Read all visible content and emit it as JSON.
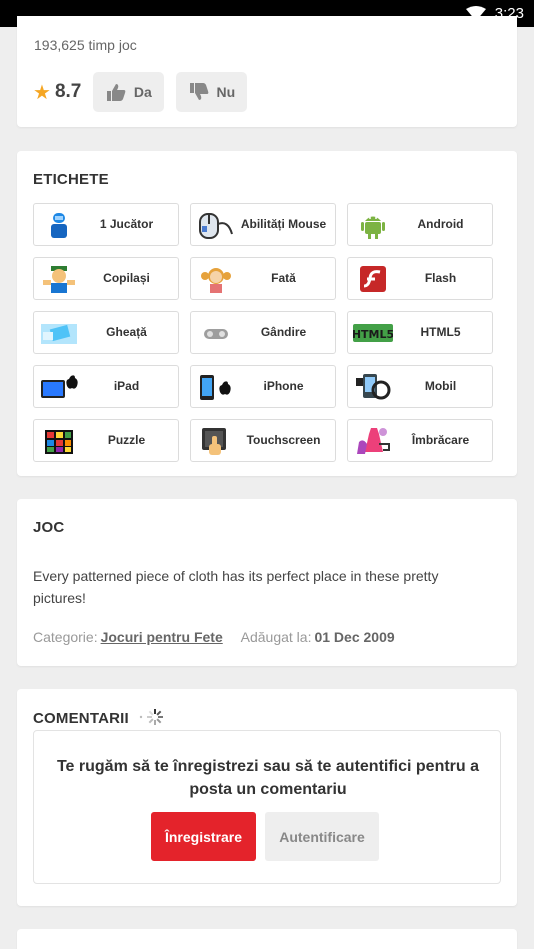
{
  "status_bar": {
    "time": "3:23"
  },
  "stats": {
    "plays": "193,625 timp joc",
    "rating": "8.7",
    "like_label": "Da",
    "dislike_label": "Nu"
  },
  "tags_section": {
    "title": "ETICHETE",
    "tags": [
      {
        "label": "1 Jucător",
        "icon": "single-player-icon"
      },
      {
        "label": "Abilități Mouse",
        "icon": "mouse-skill-icon"
      },
      {
        "label": "Android",
        "icon": "android-icon"
      },
      {
        "label": "Copilași",
        "icon": "kids-icon"
      },
      {
        "label": "Fată",
        "icon": "girl-icon"
      },
      {
        "label": "Flash",
        "icon": "flash-icon"
      },
      {
        "label": "Gheață",
        "icon": "ice-icon"
      },
      {
        "label": "Gândire",
        "icon": "thinking-icon"
      },
      {
        "label": "HTML5",
        "icon": "html5-icon"
      },
      {
        "label": "iPad",
        "icon": "ipad-icon"
      },
      {
        "label": "iPhone",
        "icon": "iphone-icon"
      },
      {
        "label": "Mobil",
        "icon": "mobile-icon"
      },
      {
        "label": "Puzzle",
        "icon": "puzzle-icon"
      },
      {
        "label": "Touchscreen",
        "icon": "touchscreen-icon"
      },
      {
        "label": "Îmbrăcare",
        "icon": "dress-up-icon"
      }
    ]
  },
  "game_section": {
    "title": "JOC",
    "description": "Every patterned piece of cloth has its perfect place in these pretty pictures!",
    "category_label": "Categorie:",
    "category_value": "Jocuri pentru Fete",
    "added_label": "Adăugat la:",
    "added_value": "01 Dec 2009"
  },
  "comments_section": {
    "title": "COMENTARII",
    "login_message": "Te rugăm să te înregistrezi sau să te autentifici pentru a posta un comentariu",
    "register_label": "Înregistrare",
    "login_label": "Autentificare"
  },
  "colors": {
    "accent": "#e4232b",
    "star": "#f5a623",
    "background": "#eeeeee"
  }
}
